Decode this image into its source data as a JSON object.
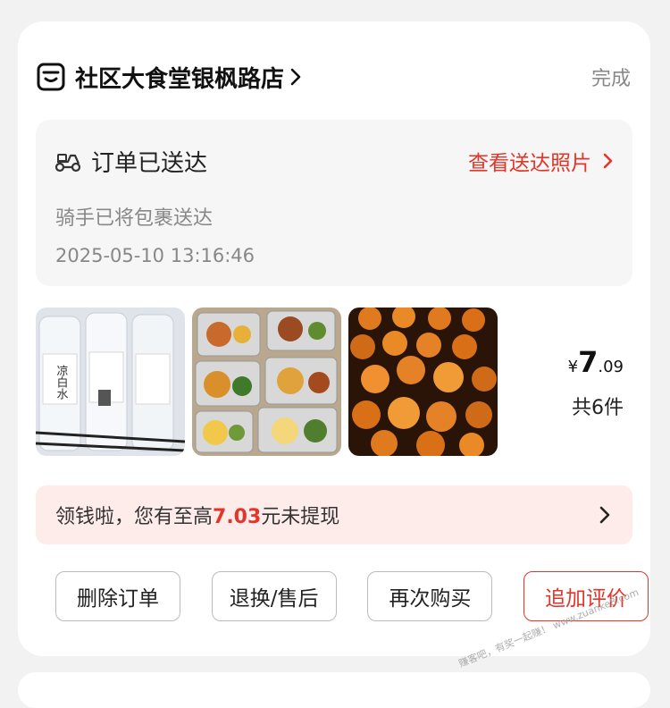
{
  "store": {
    "name": "社区大食堂银枫路店",
    "status": "完成"
  },
  "delivery": {
    "title": "订单已送达",
    "photo_link": "查看送达照片",
    "subtitle": "骑手已将包裹送达",
    "time": "2025-05-10 13:16:46"
  },
  "items": [
    {
      "name": "凉白水",
      "icon": "water-bottles-image"
    },
    {
      "icon": "meal-trays-image"
    },
    {
      "icon": "braised-eggs-image"
    }
  ],
  "summary": {
    "currency": "¥",
    "price_int": "7",
    "price_dec": ".09",
    "count": "共6件"
  },
  "cash_banner": {
    "prefix": "领钱啦，您有至高",
    "amount": "7.03",
    "suffix": "元未提现"
  },
  "actions": {
    "delete": "删除订单",
    "refund": "退换/售后",
    "rebuy": "再次购买",
    "review": "追加评价"
  },
  "watermark": "赚客吧，有奖一起赚！ www.zuanke8.com",
  "colors": {
    "accent": "#e3352a",
    "banner_bg": "#fdecea",
    "muted": "#888888"
  }
}
